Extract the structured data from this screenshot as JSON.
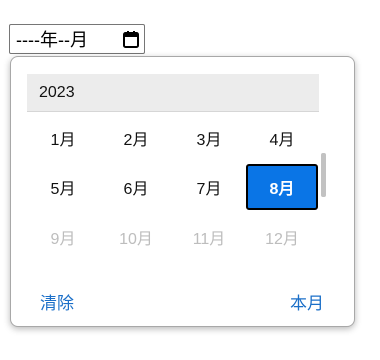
{
  "input": {
    "value": "----年--月",
    "icon": "calendar-icon"
  },
  "picker": {
    "year": "2023",
    "months": [
      {
        "label": "1月",
        "state": "normal"
      },
      {
        "label": "2月",
        "state": "normal"
      },
      {
        "label": "3月",
        "state": "normal"
      },
      {
        "label": "4月",
        "state": "normal"
      },
      {
        "label": "5月",
        "state": "normal"
      },
      {
        "label": "6月",
        "state": "normal"
      },
      {
        "label": "7月",
        "state": "normal"
      },
      {
        "label": "8月",
        "state": "selected"
      },
      {
        "label": "9月",
        "state": "disabled"
      },
      {
        "label": "10月",
        "state": "disabled"
      },
      {
        "label": "11月",
        "state": "disabled"
      },
      {
        "label": "12月",
        "state": "disabled"
      }
    ],
    "clear_label": "清除",
    "this_month_label": "本月"
  },
  "colors": {
    "selected_bg": "#0a75e6",
    "link": "#1b6fc8",
    "disabled_text": "#bdbdbd",
    "year_header_bg": "#ececec"
  }
}
